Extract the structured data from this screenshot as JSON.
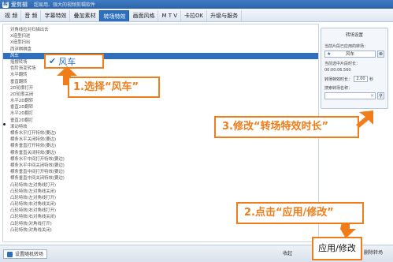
{
  "window": {
    "logo": "剪",
    "app_name": "爱剪辑",
    "slogan": "超易用、强大的视频剪辑软件"
  },
  "tabs": [
    "视  频",
    "音  频",
    "字幕特效",
    "叠加素材",
    "转场特效",
    "画面风格",
    "M T V",
    "卡拉OK",
    "升级与服务"
  ],
  "active_tab": 4,
  "effects_list": [
    "对角线拉对扫描出去",
    "X造型扫进",
    "X造型扫出",
    "西洋棋棋盘",
    "风车",
    "摇摆转场",
    "色阶渐变转场",
    "水平翻转",
    "垂直翻转",
    "2D轮廓打开",
    "2D轮廓关闭",
    "水平2D翻转",
    "垂直2D翻转",
    "水平2D翻打",
    "垂直2D翻打",
    "滚动特效",
    "横条水平打开特效(要边)",
    "横条水平关闭特效(要边)",
    "横条垂直打开特效(要边)",
    "横条垂直关闭特效(要边)",
    "横条水平中间打开特效(要边)",
    "横条水平中间关闭特效(要边)",
    "横条垂直中间打开特效(要边)",
    "横条垂直中间关闭特效(要边)",
    "凸轮特效(左对角线打开)",
    "凸轮特效(左对角线关闭)",
    "凸轮特效(左对角线打开)",
    "凸轮特效(右对角线关闭)",
    "凸轮特效(右对角线打开)",
    "凸轮特效(右对角线关闭)",
    "凸轮特效(对角线打开)",
    "凸轮特效(对角线关闭)"
  ],
  "selected_index": 4,
  "selected_label": "风车",
  "callouts": {
    "step1": "1.选择“风车”",
    "step2": "2.点击“应用/修改”",
    "step3": "3.修改“转场特效时长”"
  },
  "settings": {
    "title": "转场设置",
    "current_label": "当前片段已应用的转场：",
    "current_value": "风车",
    "time_label": "当前选中片段时长：",
    "time_value": "00:00:06.560",
    "duration_label": "转场特效时长：",
    "duration_value": "2.00",
    "duration_unit": "秒",
    "search_label": "搜索转场名称："
  },
  "bottom": {
    "random_label": "设置随机转场",
    "collapse_label": "收起",
    "apply_label": "应用/修改",
    "delete_label": "删除转场"
  },
  "colors": {
    "accent": "#2f6fc0",
    "callout": "#f07d1a"
  }
}
